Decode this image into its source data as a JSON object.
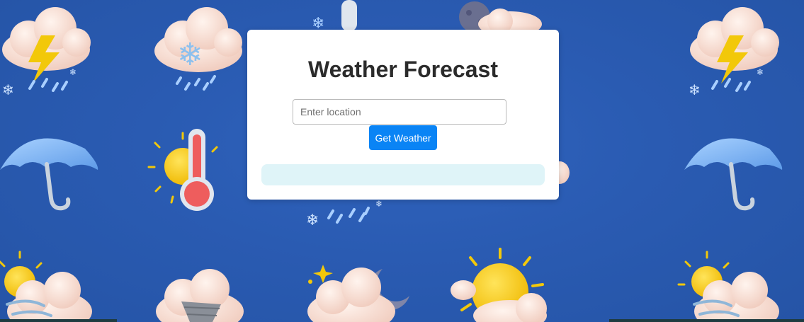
{
  "header": {
    "title": "Weather Forecast"
  },
  "search": {
    "placeholder": "Enter location",
    "value": "",
    "button_label": "Get Weather"
  },
  "result": {
    "text": ""
  },
  "colors": {
    "background": "#2a5bb2",
    "card": "#ffffff",
    "button": "#0a84f5",
    "result_box": "#dff4f8"
  }
}
